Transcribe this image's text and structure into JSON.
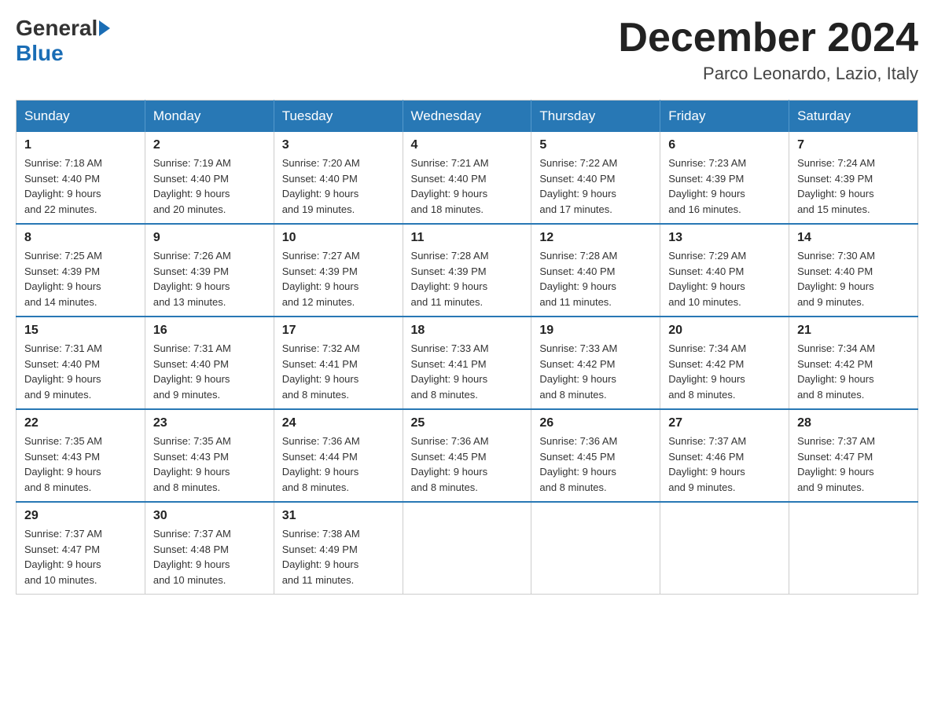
{
  "header": {
    "logo_general": "General",
    "logo_blue": "Blue",
    "month_title": "December 2024",
    "location": "Parco Leonardo, Lazio, Italy"
  },
  "days_of_week": [
    "Sunday",
    "Monday",
    "Tuesday",
    "Wednesday",
    "Thursday",
    "Friday",
    "Saturday"
  ],
  "weeks": [
    [
      {
        "day": "1",
        "sunrise": "7:18 AM",
        "sunset": "4:40 PM",
        "daylight": "9 hours and 22 minutes."
      },
      {
        "day": "2",
        "sunrise": "7:19 AM",
        "sunset": "4:40 PM",
        "daylight": "9 hours and 20 minutes."
      },
      {
        "day": "3",
        "sunrise": "7:20 AM",
        "sunset": "4:40 PM",
        "daylight": "9 hours and 19 minutes."
      },
      {
        "day": "4",
        "sunrise": "7:21 AM",
        "sunset": "4:40 PM",
        "daylight": "9 hours and 18 minutes."
      },
      {
        "day": "5",
        "sunrise": "7:22 AM",
        "sunset": "4:40 PM",
        "daylight": "9 hours and 17 minutes."
      },
      {
        "day": "6",
        "sunrise": "7:23 AM",
        "sunset": "4:39 PM",
        "daylight": "9 hours and 16 minutes."
      },
      {
        "day": "7",
        "sunrise": "7:24 AM",
        "sunset": "4:39 PM",
        "daylight": "9 hours and 15 minutes."
      }
    ],
    [
      {
        "day": "8",
        "sunrise": "7:25 AM",
        "sunset": "4:39 PM",
        "daylight": "9 hours and 14 minutes."
      },
      {
        "day": "9",
        "sunrise": "7:26 AM",
        "sunset": "4:39 PM",
        "daylight": "9 hours and 13 minutes."
      },
      {
        "day": "10",
        "sunrise": "7:27 AM",
        "sunset": "4:39 PM",
        "daylight": "9 hours and 12 minutes."
      },
      {
        "day": "11",
        "sunrise": "7:28 AM",
        "sunset": "4:39 PM",
        "daylight": "9 hours and 11 minutes."
      },
      {
        "day": "12",
        "sunrise": "7:28 AM",
        "sunset": "4:40 PM",
        "daylight": "9 hours and 11 minutes."
      },
      {
        "day": "13",
        "sunrise": "7:29 AM",
        "sunset": "4:40 PM",
        "daylight": "9 hours and 10 minutes."
      },
      {
        "day": "14",
        "sunrise": "7:30 AM",
        "sunset": "4:40 PM",
        "daylight": "9 hours and 9 minutes."
      }
    ],
    [
      {
        "day": "15",
        "sunrise": "7:31 AM",
        "sunset": "4:40 PM",
        "daylight": "9 hours and 9 minutes."
      },
      {
        "day": "16",
        "sunrise": "7:31 AM",
        "sunset": "4:40 PM",
        "daylight": "9 hours and 9 minutes."
      },
      {
        "day": "17",
        "sunrise": "7:32 AM",
        "sunset": "4:41 PM",
        "daylight": "9 hours and 8 minutes."
      },
      {
        "day": "18",
        "sunrise": "7:33 AM",
        "sunset": "4:41 PM",
        "daylight": "9 hours and 8 minutes."
      },
      {
        "day": "19",
        "sunrise": "7:33 AM",
        "sunset": "4:42 PM",
        "daylight": "9 hours and 8 minutes."
      },
      {
        "day": "20",
        "sunrise": "7:34 AM",
        "sunset": "4:42 PM",
        "daylight": "9 hours and 8 minutes."
      },
      {
        "day": "21",
        "sunrise": "7:34 AM",
        "sunset": "4:42 PM",
        "daylight": "9 hours and 8 minutes."
      }
    ],
    [
      {
        "day": "22",
        "sunrise": "7:35 AM",
        "sunset": "4:43 PM",
        "daylight": "9 hours and 8 minutes."
      },
      {
        "day": "23",
        "sunrise": "7:35 AM",
        "sunset": "4:43 PM",
        "daylight": "9 hours and 8 minutes."
      },
      {
        "day": "24",
        "sunrise": "7:36 AM",
        "sunset": "4:44 PM",
        "daylight": "9 hours and 8 minutes."
      },
      {
        "day": "25",
        "sunrise": "7:36 AM",
        "sunset": "4:45 PM",
        "daylight": "9 hours and 8 minutes."
      },
      {
        "day": "26",
        "sunrise": "7:36 AM",
        "sunset": "4:45 PM",
        "daylight": "9 hours and 8 minutes."
      },
      {
        "day": "27",
        "sunrise": "7:37 AM",
        "sunset": "4:46 PM",
        "daylight": "9 hours and 9 minutes."
      },
      {
        "day": "28",
        "sunrise": "7:37 AM",
        "sunset": "4:47 PM",
        "daylight": "9 hours and 9 minutes."
      }
    ],
    [
      {
        "day": "29",
        "sunrise": "7:37 AM",
        "sunset": "4:47 PM",
        "daylight": "9 hours and 10 minutes."
      },
      {
        "day": "30",
        "sunrise": "7:37 AM",
        "sunset": "4:48 PM",
        "daylight": "9 hours and 10 minutes."
      },
      {
        "day": "31",
        "sunrise": "7:38 AM",
        "sunset": "4:49 PM",
        "daylight": "9 hours and 11 minutes."
      },
      null,
      null,
      null,
      null
    ]
  ],
  "labels": {
    "sunrise": "Sunrise:",
    "sunset": "Sunset:",
    "daylight": "Daylight:"
  }
}
